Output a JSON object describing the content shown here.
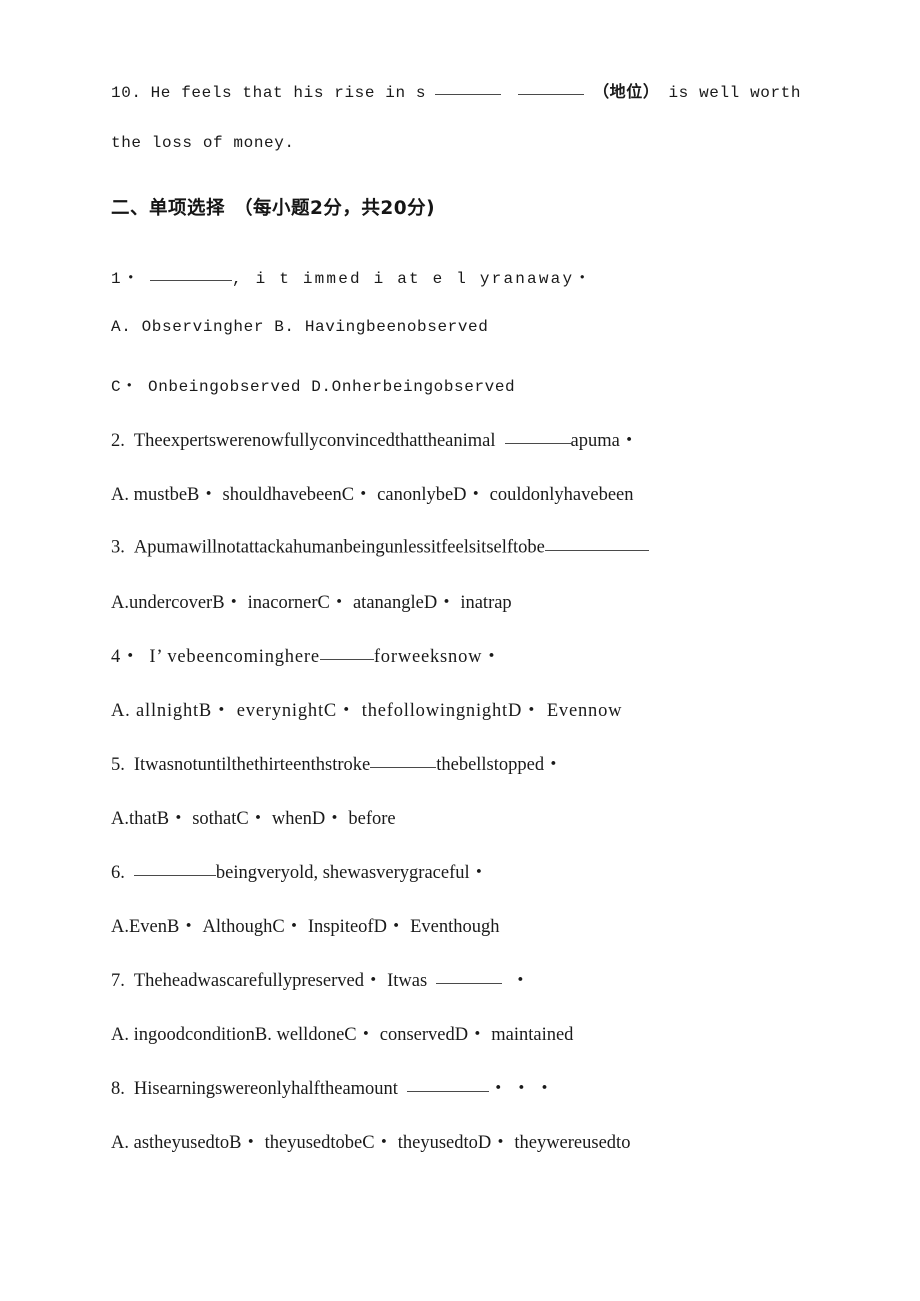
{
  "document": {
    "type": "english-exam-worksheet",
    "background_color": "#ffffff",
    "text_color": "#1d1d1d"
  },
  "carryover_question": {
    "number": "10.",
    "line1_before_blank": "He feels that his rise in s",
    "line1_after_blanks": "is well worth",
    "parenthetical": "（地位）",
    "line2": "the loss of money."
  },
  "section": {
    "index": "二、",
    "title": "单项选择",
    "scoring": "（每小题2分，共20分)"
  },
  "questions": [
    {
      "number": "1・",
      "stem_before_blank": "",
      "stem_after_blank": ", i t immed i at e l yranaway・",
      "options_line1": "A.  Observingher B. Havingbeenobserved",
      "options_line2": "C・ Onbeingobserved D.Onherbeingobserved"
    },
    {
      "number": "2.",
      "stem_before_blank": "Theexpertswerenowfullyconvincedthattheanimal",
      "stem_after_blank": "apuma・",
      "options_line1": "A.  mustbeB・ shouldhavebeenC・ canonlybeD・ couldonlyhavebeen",
      "options_line2": ""
    },
    {
      "number": "3.",
      "stem_before_blank": "Apumawillnotattackahumanbeingunlessitfeelsitselftobe",
      "stem_after_blank": "",
      "options_line1": "A.undercoverB・ inacornerC・ atanangleD・ inatrap",
      "options_line2": ""
    },
    {
      "number": "4・",
      "stem_before_blank": "I’ vebeencominghere",
      "stem_after_blank": "forweeksnow・",
      "options_line1": "A.  allnightB・ everynightC・ thefollowingnightD・ Evennow",
      "options_line2": ""
    },
    {
      "number": "5.",
      "stem_before_blank": "Itwasnotuntilthethirteenthstroke",
      "stem_after_blank": "thebellstopped・",
      "options_line1": "A.thatB・ sothatC・ whenD・ before",
      "options_line2": ""
    },
    {
      "number": "6.",
      "stem_before_blank": "",
      "stem_after_blank": "beingveryold, shewasverygraceful・",
      "options_line1": "A.EvenB・ AlthoughC・ InspiteofD・ Eventhough",
      "options_line2": ""
    },
    {
      "number": "7.",
      "stem_before_blank": "Theheadwascarefullypreserved・ Itwas",
      "stem_after_blank": "・",
      "options_line1": "A.  ingoodconditionB. welldoneC・ conservedD・ maintained",
      "options_line2": ""
    },
    {
      "number": "8.",
      "stem_before_blank": "Hisearningswereonlyhalftheamount",
      "stem_after_blank": "・ ・ ・",
      "options_line1": "A.  astheyusedtoB・ theyusedtobeC・ theyusedtoD・ theywereusedto",
      "options_line2": ""
    }
  ]
}
